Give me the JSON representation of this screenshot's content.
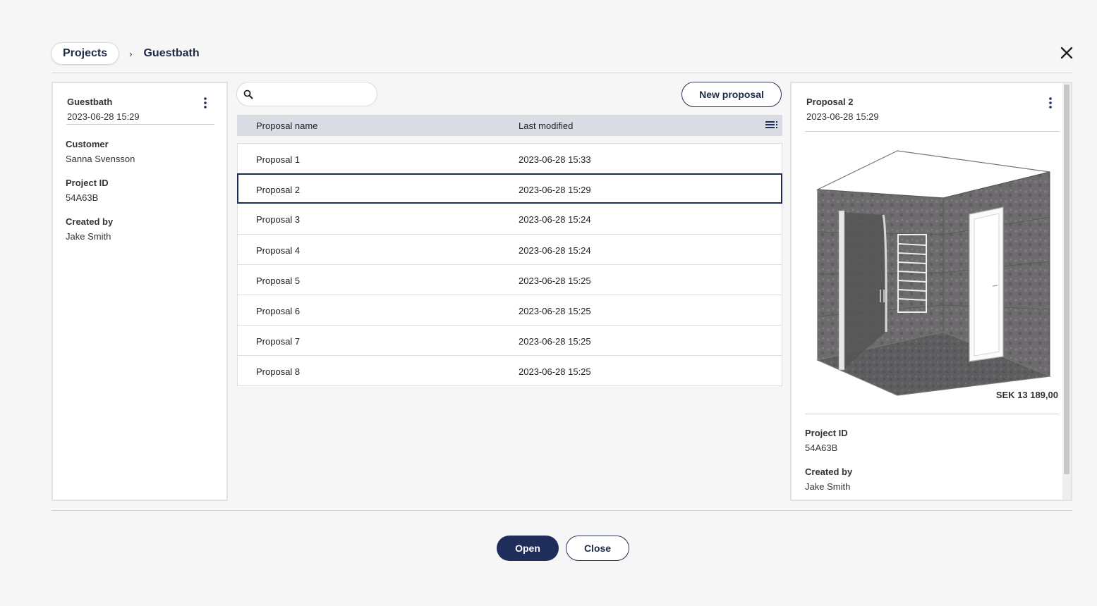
{
  "breadcrumb": {
    "root": "Projects",
    "separator": "›",
    "current": "Guestbath"
  },
  "project": {
    "name": "Guestbath",
    "modified": "2023-06-28 15:29",
    "customer_label": "Customer",
    "customer": "Sanna Svensson",
    "project_id_label": "Project ID",
    "project_id": "54A63B",
    "created_by_label": "Created by",
    "created_by": "Jake Smith"
  },
  "search": {
    "placeholder": "",
    "value": ""
  },
  "toolbar": {
    "new_proposal_label": "New proposal"
  },
  "table": {
    "headers": {
      "name": "Proposal name",
      "modified": "Last modified"
    },
    "rows": [
      {
        "name": "Proposal 1",
        "modified": "2023-06-28 15:33"
      },
      {
        "name": "Proposal 2",
        "modified": "2023-06-28 15:29"
      },
      {
        "name": "Proposal 3",
        "modified": "2023-06-28 15:24"
      },
      {
        "name": "Proposal 4",
        "modified": "2023-06-28 15:24"
      },
      {
        "name": "Proposal 5",
        "modified": "2023-06-28 15:25"
      },
      {
        "name": "Proposal 6",
        "modified": "2023-06-28 15:25"
      },
      {
        "name": "Proposal 7",
        "modified": "2023-06-28 15:25"
      },
      {
        "name": "Proposal 8",
        "modified": "2023-06-28 15:25"
      }
    ]
  },
  "preview": {
    "title": "Proposal 2",
    "modified": "2023-06-28 15:29",
    "price": "SEK 13 189,00",
    "project_id_label": "Project ID",
    "project_id": "54A63B",
    "created_by_label": "Created by",
    "created_by": "Jake Smith"
  },
  "footer": {
    "open_label": "Open",
    "close_label": "Close"
  },
  "colors": {
    "primary": "#1f2d5a",
    "header_row": "#d9dce3",
    "background": "#f6f6f6"
  },
  "icons": {
    "close": "close-icon",
    "search": "search-icon",
    "more": "more-vertical-icon",
    "columns": "column-menu-icon"
  }
}
